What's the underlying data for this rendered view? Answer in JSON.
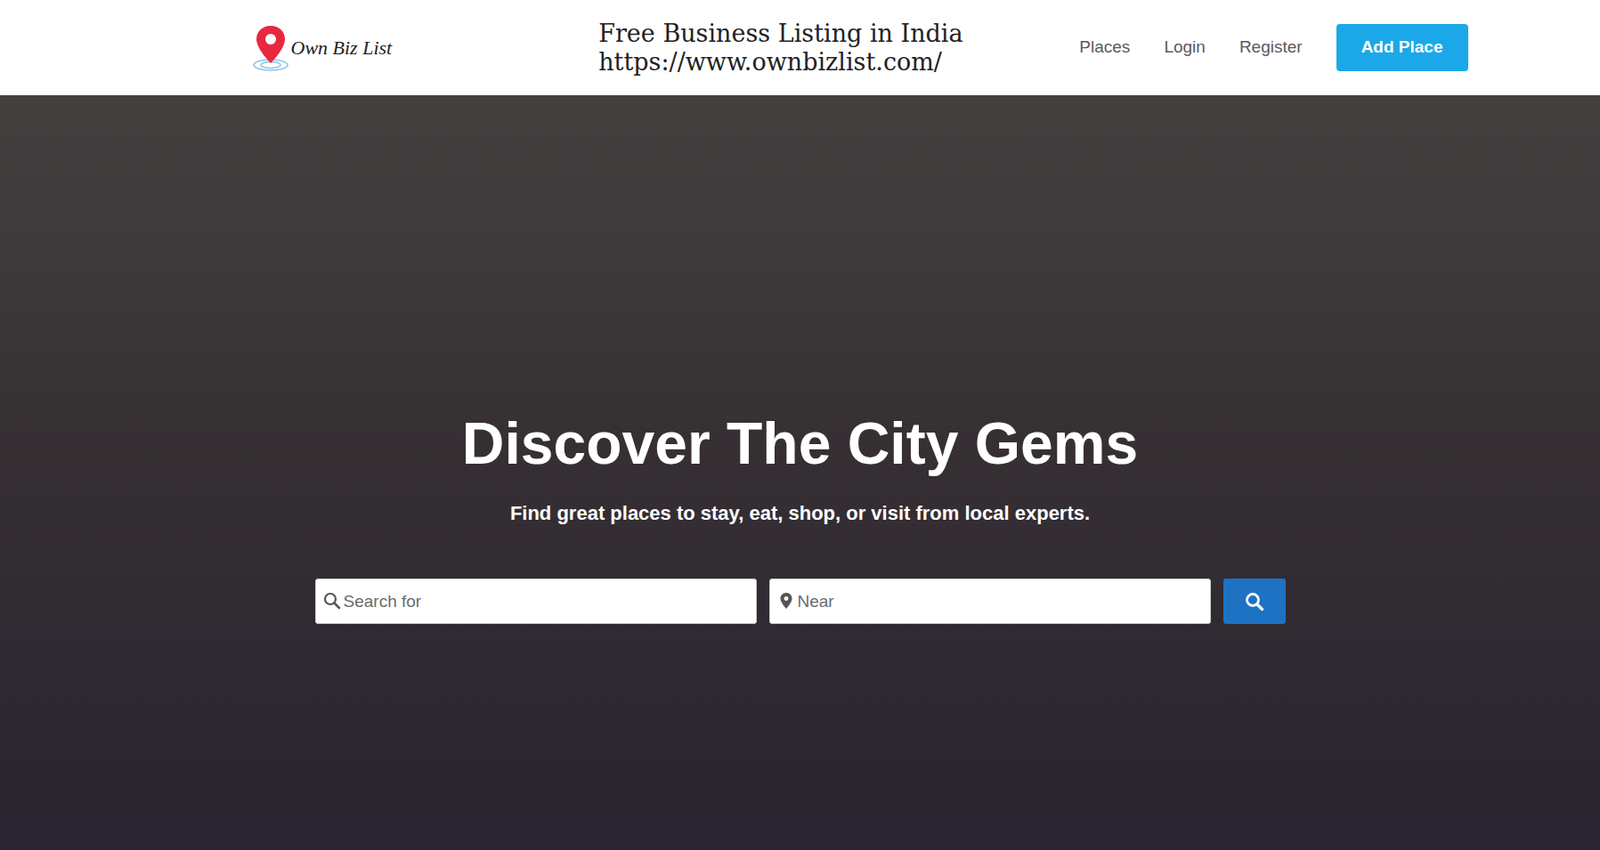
{
  "header": {
    "logo_text": "Own Biz List",
    "title_lines": [
      "Free Business Listing in India",
      "https://www.ownbizlist.com/"
    ],
    "nav": [
      "Places",
      "Login",
      "Register"
    ],
    "add_button": "Add Place"
  },
  "hero": {
    "title": "Discover The City Gems",
    "subtitle": "Find great places to stay, eat, shop, or visit from local experts.",
    "search": {
      "for_placeholder": "Search for",
      "near_placeholder": "Near"
    }
  }
}
